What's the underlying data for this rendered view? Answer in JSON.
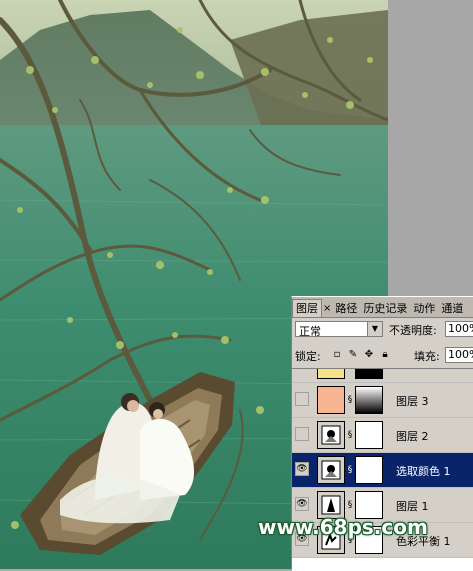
{
  "photo": {
    "description_icon": "wedding-couple-boat-lake-photo"
  },
  "watermark": {
    "text": "www.68ps.com"
  },
  "layers_panel": {
    "tabs": [
      {
        "label": "图层",
        "active": true
      },
      {
        "label": "×",
        "is_close": true
      },
      {
        "label": "路径"
      },
      {
        "label": "历史记录"
      },
      {
        "label": "动作"
      },
      {
        "label": "通道"
      }
    ],
    "blend_mode": "正常",
    "opacity_label": "不透明度:",
    "opacity_value": "100%",
    "lock_label": "锁定:",
    "fill_label": "填充:",
    "fill_value": "100%",
    "layers": [
      {
        "name": "",
        "visible": false,
        "thumb_color": "#f6e08a",
        "has_mask": true,
        "mask_color": "#000000",
        "partial": true
      },
      {
        "name": "图层 3",
        "visible": false,
        "thumb_color": "#f7b591",
        "has_mask": true,
        "mask_type": "gradient"
      },
      {
        "name": "图层 2",
        "visible": false,
        "thumb_icon": "adjustment-icon",
        "has_mask": true,
        "mask_color": "#ffffff"
      },
      {
        "name": "选取颜色 1",
        "visible": true,
        "selected": true,
        "thumb_icon": "adjustment-icon",
        "has_mask": true,
        "mask_color": "#ffffff"
      },
      {
        "name": "图层 1",
        "visible": true,
        "thumb_icon": "adjustment-icon",
        "has_mask": true,
        "mask_color": "#ffffff"
      },
      {
        "name": "色彩平衡 1",
        "visible": true,
        "thumb_icon": "balance-icon",
        "has_mask": true,
        "mask_color": "#ffffff"
      }
    ]
  },
  "colors": {
    "selection": "#0a246a",
    "panel_bg": "#d4d0c8",
    "water": "#3a8a6a"
  }
}
